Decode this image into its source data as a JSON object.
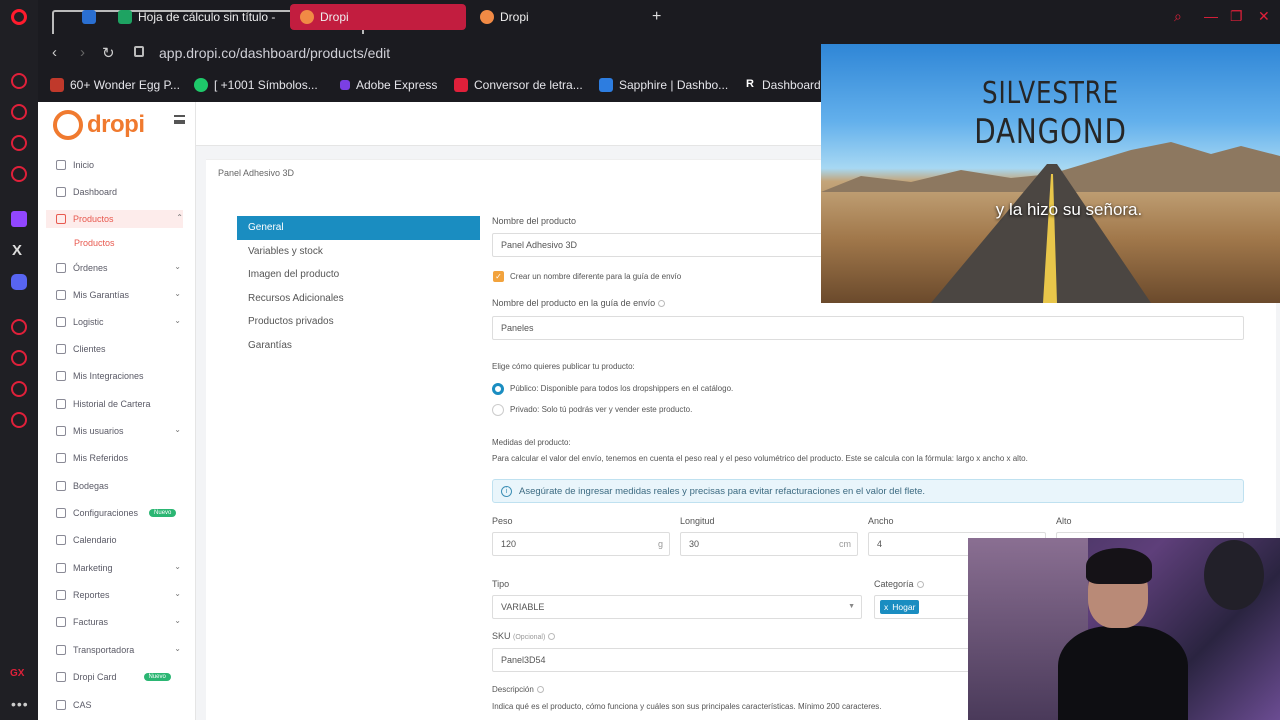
{
  "browser": {
    "tabs": [
      {
        "label": "Hoja de cálculo sin título - "
      },
      {
        "label": "Dropi"
      },
      {
        "label": "Dropi"
      }
    ],
    "url": "app.dropi.co/dashboard/products/edit",
    "bookmarks": [
      {
        "label": "60+ Wonder Egg P..."
      },
      {
        "label": "[ +1001 Símbolos..."
      },
      {
        "label": "Adobe Express"
      },
      {
        "label": "Conversor de letra..."
      },
      {
        "label": "Sapphire | Dashbo..."
      },
      {
        "label": "Dashboard"
      }
    ],
    "rail_gx": "GX",
    "rail_x": "X"
  },
  "app": {
    "logo_text": "dropi",
    "breadcrumb": "Panel Adhesivo 3D",
    "sidebar": [
      {
        "label": "Inicio"
      },
      {
        "label": "Dashboard"
      },
      {
        "label": "Productos"
      },
      {
        "label": "Productos"
      },
      {
        "label": "Órdenes"
      },
      {
        "label": "Mis Garantías"
      },
      {
        "label": "Logistic"
      },
      {
        "label": "Clientes"
      },
      {
        "label": "Mis Integraciones"
      },
      {
        "label": "Historial de Cartera"
      },
      {
        "label": "Mis usuarios"
      },
      {
        "label": "Mis Referidos"
      },
      {
        "label": "Bodegas"
      },
      {
        "label": "Configuraciones",
        "badge": "Nuevo"
      },
      {
        "label": "Calendario"
      },
      {
        "label": "Marketing"
      },
      {
        "label": "Reportes"
      },
      {
        "label": "Facturas"
      },
      {
        "label": "Transportadora"
      },
      {
        "label": "Dropi Card",
        "badge": "Nuevo"
      },
      {
        "label": "CAS"
      }
    ],
    "tabs": [
      {
        "label": "General"
      },
      {
        "label": "Variables y stock"
      },
      {
        "label": "Imagen del producto"
      },
      {
        "label": "Recursos Adicionales"
      },
      {
        "label": "Productos privados"
      },
      {
        "label": "Garantías"
      }
    ],
    "form": {
      "name_label": "Nombre del producto",
      "name_value": "Panel Adhesivo 3D",
      "checkbox_label": "Crear un nombre diferente para la guía de envío",
      "guide_name_label": "Nombre del producto en la guía de envío",
      "guide_name_value": "Paneles",
      "publish_label": "Elige cómo quieres publicar tu producto:",
      "public_option": "Público:  Disponible para todos los dropshippers en el catálogo.",
      "private_option": "Privado:  Solo tú podrás ver y vender este producto.",
      "measures_label": "Medidas del producto:",
      "measures_help": "Para calcular el valor del envío, tenemos en cuenta el peso real y el peso volumétrico del producto. Este se calcula con la fórmula: largo x ancho x alto.",
      "alert": "Asegúrate de ingresar medidas reales y precisas para evitar refacturaciones en el valor del flete.",
      "weight_label": "Peso",
      "weight_value": "120",
      "weight_unit": "g",
      "length_label": "Longitud",
      "length_value": "30",
      "length_unit": "cm",
      "width_label": "Ancho",
      "width_value": "4",
      "height_label": "Alto",
      "type_label": "Tipo",
      "type_value": "VARIABLE",
      "category_label": "Categoría",
      "category_tag": "Hogar",
      "tag_x": "x",
      "sku_label": "SKU",
      "sku_optional": "(Opcional)",
      "sku_value": "Panel3D54",
      "description_label": "Descripción",
      "description_help": "Indica qué es el producto, cómo funciona y cuáles son sus principales características. Mínimo 200 caracteres."
    }
  },
  "video": {
    "title_line1": "SILVESTRE",
    "title_line2": "DANGOND",
    "subtitle": "y la hizo su señora."
  }
}
